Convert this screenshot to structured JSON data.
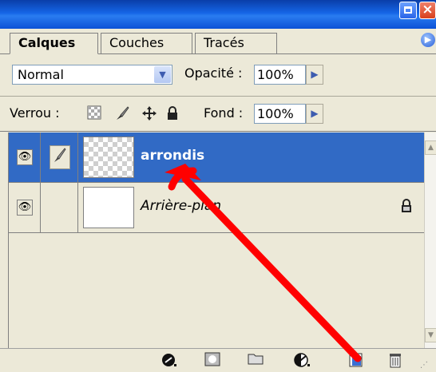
{
  "window": {
    "close_glyph": "×"
  },
  "tabs": [
    {
      "label": "Calques",
      "active": true
    },
    {
      "label": "Couches",
      "active": false
    },
    {
      "label": "Tracés",
      "active": false
    }
  ],
  "blend_mode": {
    "value": "Normal"
  },
  "opacity": {
    "label": "Opacité :",
    "value": "100%"
  },
  "lock": {
    "label": "Verrou :",
    "icons": [
      "lock-transparency-icon",
      "lock-paint-icon",
      "lock-move-icon",
      "lock-all-icon"
    ]
  },
  "fill": {
    "label": "Fond :",
    "value": "100%"
  },
  "layers": [
    {
      "name": "arrondis",
      "selected": true,
      "visible": true,
      "transparent_thumb": true
    },
    {
      "name": "Arrière-plan",
      "selected": false,
      "visible": true,
      "locked": true,
      "italic": true
    }
  ],
  "bottom_icons": [
    "link-layers-icon",
    "layer-mask-icon",
    "new-group-icon",
    "adjustment-layer-icon",
    "new-layer-icon",
    "trash-icon"
  ],
  "colors": {
    "selection": "#316ac5",
    "arrow": "#ff0000",
    "panel": "#ece9d8"
  }
}
